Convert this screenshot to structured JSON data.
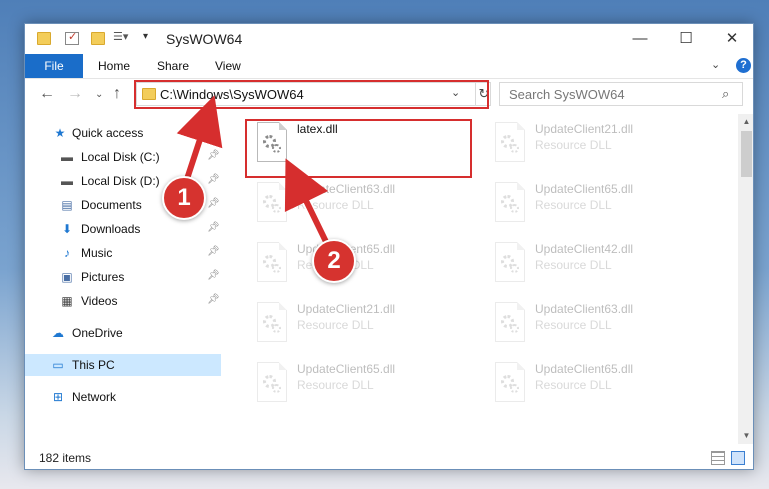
{
  "window": {
    "title": "SysWOW64"
  },
  "ribbon": {
    "file": "File",
    "home": "Home",
    "share": "Share",
    "view": "View"
  },
  "address": {
    "path": "C:\\Windows\\SysWOW64"
  },
  "search": {
    "placeholder": "Search SysWOW64"
  },
  "sidebar": {
    "items": [
      {
        "label": "Quick access"
      },
      {
        "label": "Local Disk (C:)"
      },
      {
        "label": "Local Disk (D:)"
      },
      {
        "label": "Documents"
      },
      {
        "label": "Downloads"
      },
      {
        "label": "Music"
      },
      {
        "label": "Pictures"
      },
      {
        "label": "Videos"
      },
      {
        "label": "OneDrive"
      },
      {
        "label": "This PC"
      },
      {
        "label": "Network"
      }
    ]
  },
  "files": [
    {
      "name": "latex.dll",
      "type": ""
    },
    {
      "name": "UpdateClient21.dll",
      "type": "Resource DLL"
    },
    {
      "name": "UpdateClient63.dll",
      "type": "Resource DLL"
    },
    {
      "name": "UpdateClient65.dll",
      "type": "Resource DLL"
    },
    {
      "name": "UpdateClient65.dll",
      "type": "Resource DLL"
    },
    {
      "name": "UpdateClient42.dll",
      "type": "Resource DLL"
    },
    {
      "name": "UpdateClient21.dll",
      "type": "Resource DLL"
    },
    {
      "name": "UpdateClient63.dll",
      "type": "Resource DLL"
    },
    {
      "name": "UpdateClient65.dll",
      "type": "Resource DLL"
    },
    {
      "name": "UpdateClient65.dll",
      "type": "Resource DLL"
    }
  ],
  "status": {
    "count": "182 items"
  },
  "annotations": {
    "step1": "1",
    "step2": "2",
    "color": "#d62e2e"
  }
}
